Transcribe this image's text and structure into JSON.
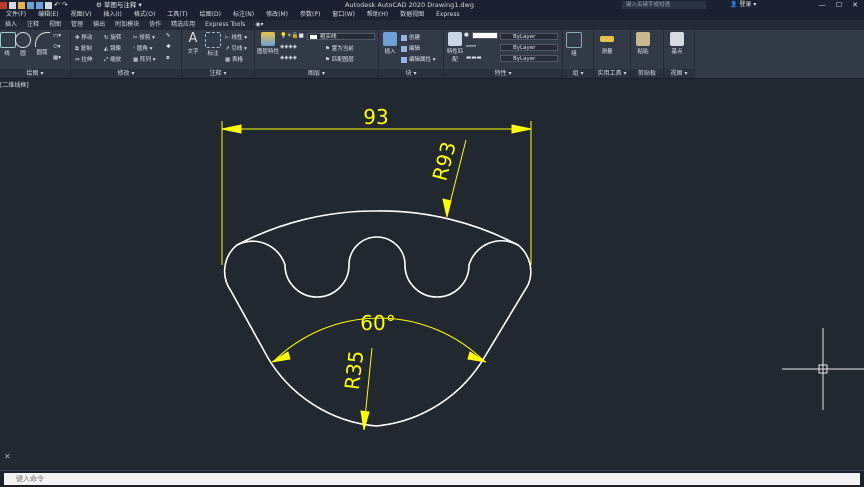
{
  "titlebar": {
    "workspace": "草图与注释",
    "app_title": "Autodesk AutoCAD 2020    Drawing1.dwg",
    "search_placeholder": "键入关键字或短语",
    "login": "登录",
    "window_controls": [
      "—",
      "☐",
      "✕"
    ]
  },
  "menubar": [
    "文件(F)",
    "编辑(E)",
    "视图(V)",
    "插入(I)",
    "格式(O)",
    "工具(T)",
    "绘图(D)",
    "标注(N)",
    "修改(M)",
    "参数(P)",
    "窗口(W)",
    "帮助(H)",
    "数据视图",
    "Express"
  ],
  "tabs": [
    "插入",
    "注释",
    "视图",
    "管理",
    "输出",
    "附加模块",
    "协作",
    "精选应用",
    "Express Tools"
  ],
  "ribbon": {
    "draw": {
      "title": "绘图",
      "buttons": [
        "线",
        "圆",
        "圆弧"
      ]
    },
    "modify": {
      "title": "修改",
      "buttons": [
        "移动",
        "旋转",
        "修剪",
        "复制",
        "镜像",
        "圆角",
        "拉伸",
        "缩放",
        "阵列"
      ]
    },
    "annotation": {
      "title": "注释",
      "buttons": [
        "文字",
        "标注",
        "线性",
        "引线",
        "表格"
      ]
    },
    "layers": {
      "title": "图层",
      "big": "图层特性",
      "layer_name": "粗实线",
      "buttons": [
        "置为当前",
        "匹配图层"
      ]
    },
    "block": {
      "title": "块",
      "big": "插入",
      "buttons": [
        "创建",
        "编辑",
        "编辑属性"
      ]
    },
    "properties": {
      "title": "特性",
      "big": "特性匹配",
      "combos": [
        "ByLayer",
        "ByLayer",
        "ByLayer"
      ]
    },
    "groups": {
      "title": "组",
      "big": "组"
    },
    "utilities": {
      "title": "实用工具",
      "big": "测量"
    },
    "clipboard": {
      "title": "剪贴板",
      "big": "粘贴"
    },
    "view": {
      "title": "视图",
      "big": "基点"
    }
  },
  "viewport_label": "[二维线框]",
  "dimensions": {
    "width": "93",
    "top_radius": "R93",
    "angle": "60°",
    "bottom_radius": "R35"
  },
  "command_line": {
    "placeholder": "键入命令"
  },
  "colors": {
    "background": "#212830",
    "geometry": "#ffffff",
    "dimension": "#ffff00",
    "ribbon": "#323a48"
  }
}
